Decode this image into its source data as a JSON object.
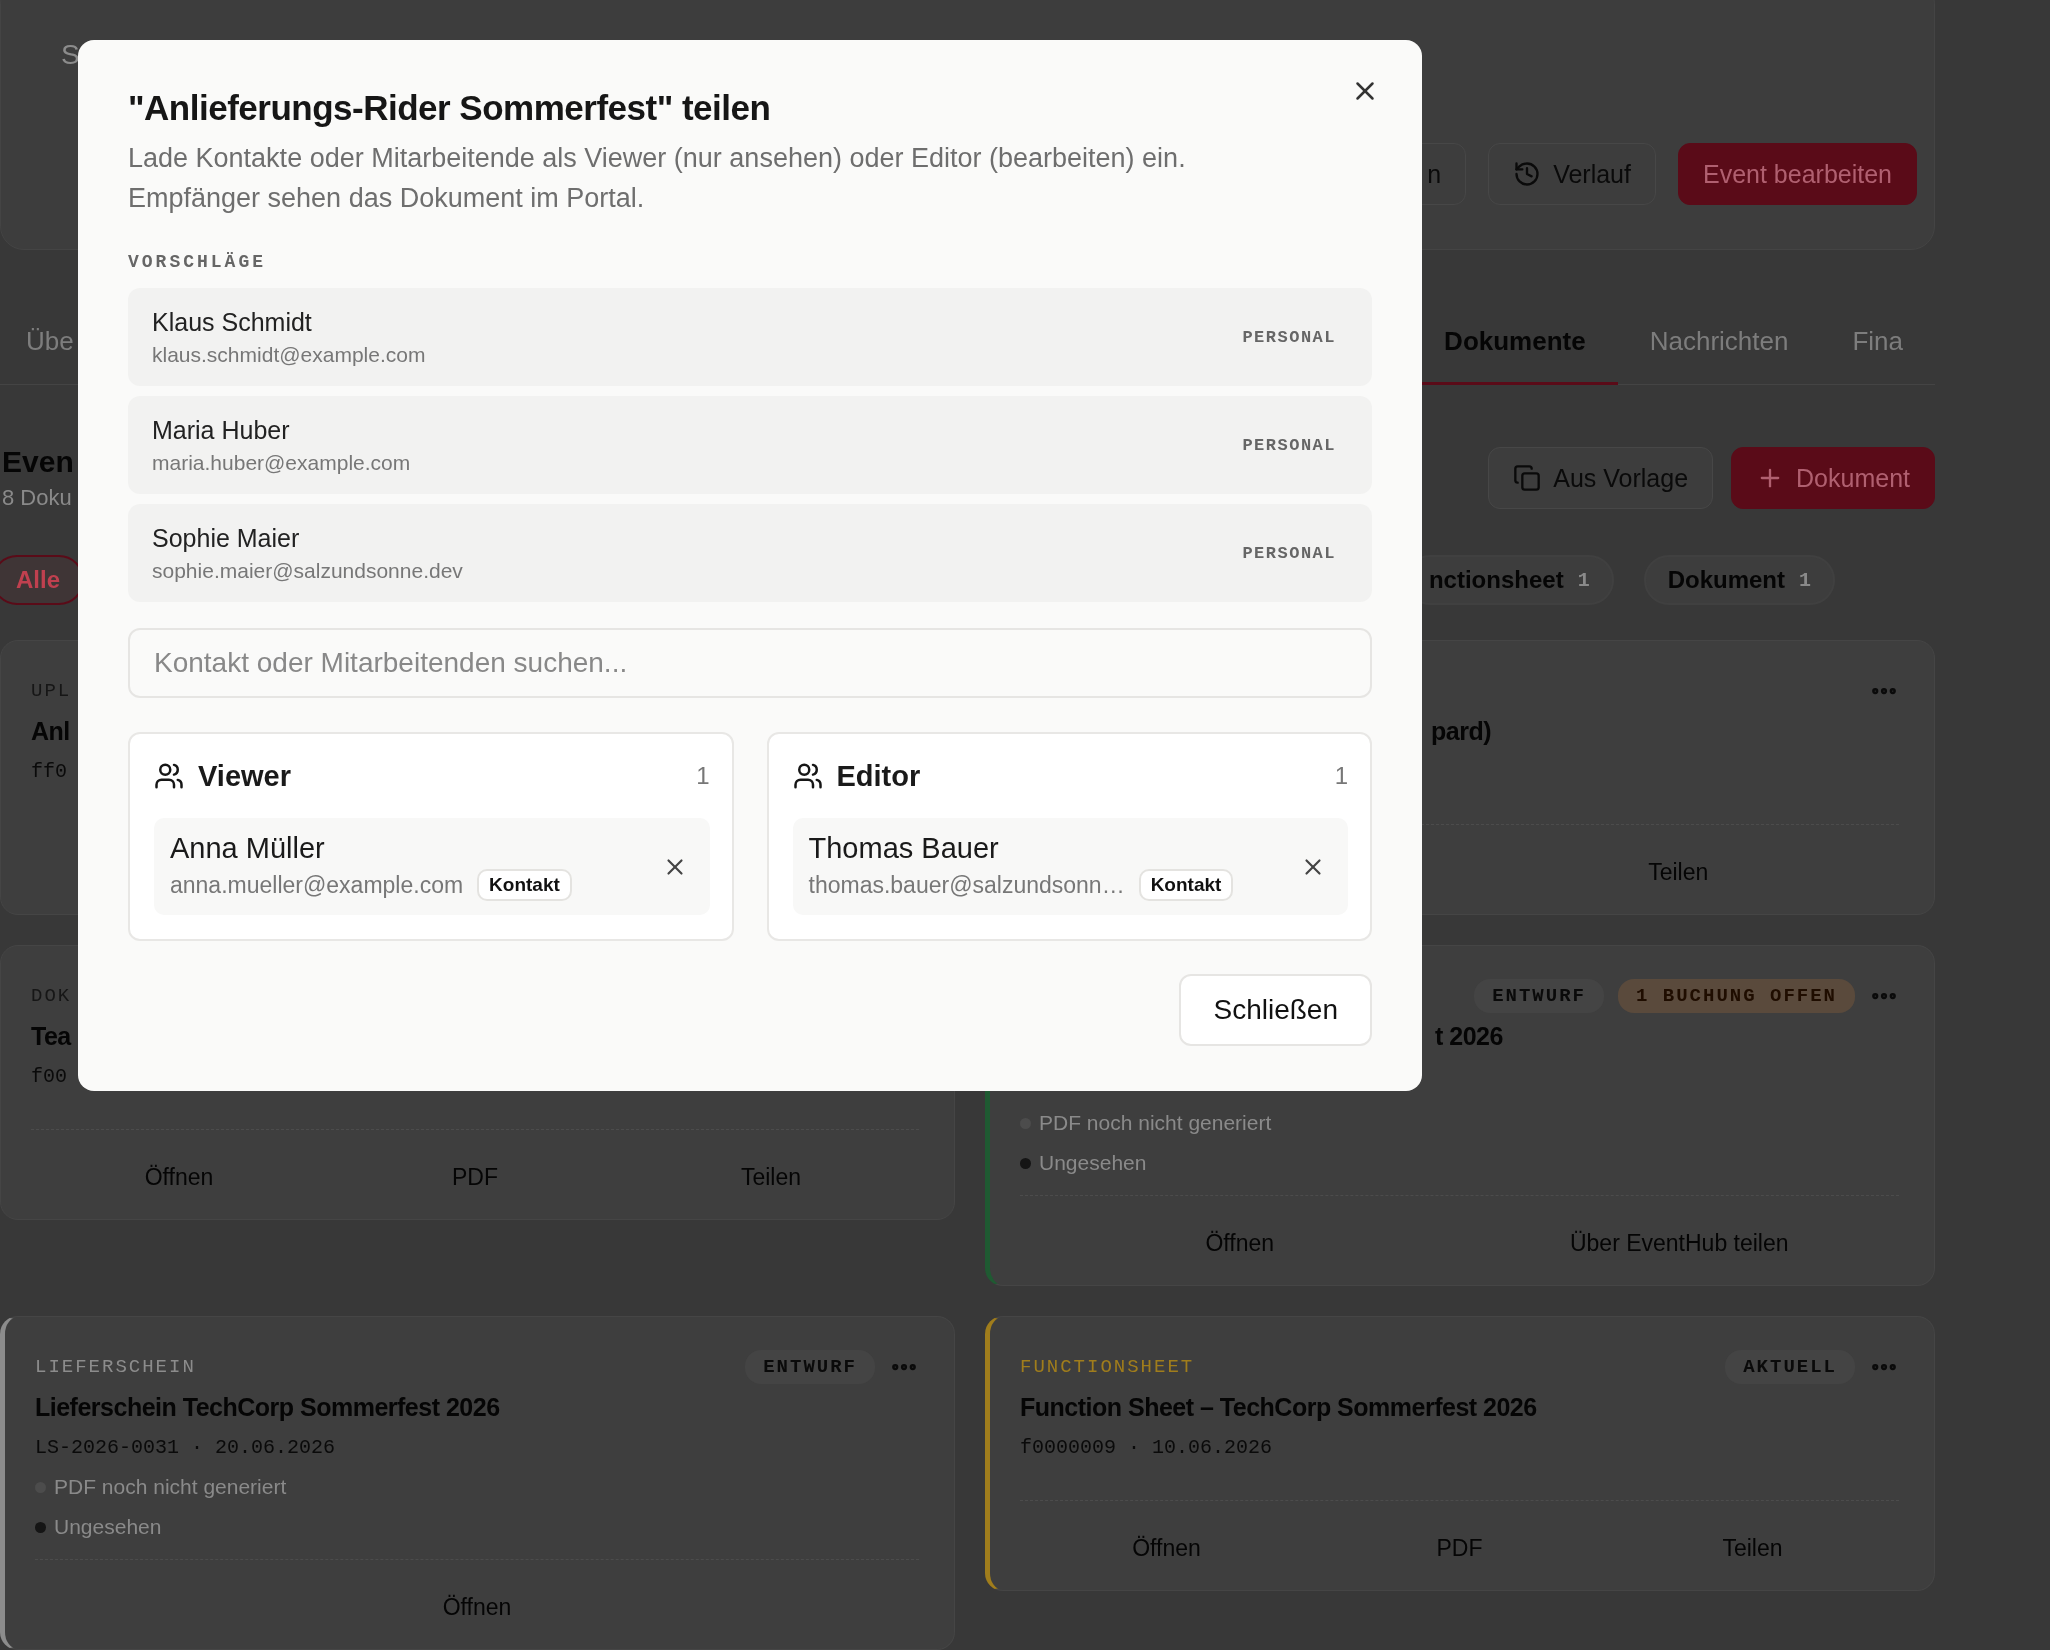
{
  "header": {
    "subtitle": "S",
    "partial_button": {
      "label": "n"
    },
    "history_button": {
      "label": "Verlauf"
    },
    "edit_button": {
      "label": "Event bearbeiten"
    }
  },
  "tabs": [
    {
      "label": "Übe",
      "selected": false
    },
    {
      "label": "Dokumente",
      "selected": true
    },
    {
      "label": "Nachrichten",
      "selected": false
    },
    {
      "label": "Fina",
      "selected": false
    }
  ],
  "section": {
    "title": "Even",
    "subtitle": "8 Doku",
    "template_button": {
      "label": "Aus Vorlage"
    },
    "new_button": {
      "label": "Dokument"
    }
  },
  "filters": [
    {
      "label": "Alle",
      "selected": true
    },
    {
      "label": "nctionsheet",
      "count": "1",
      "selected": false
    },
    {
      "label": "Dokument",
      "count": "1",
      "selected": false
    }
  ],
  "cards": [
    {
      "type": "UPL",
      "title": "Anl",
      "meta": "ff0"
    },
    {
      "kind": "pair",
      "title": "pard)",
      "title_cut": true,
      "menu": true,
      "actions": [
        "Teilen"
      ]
    },
    {
      "kind": "triple",
      "type": "DOK",
      "title": "Tea",
      "meta": "f00",
      "actions": [
        "Öffnen",
        "PDF",
        "Teilen"
      ]
    },
    {
      "kind": "pair",
      "color": "#1f5a32",
      "title": "t 2026",
      "title_cut": true,
      "menu": true,
      "badges": [
        {
          "label": "ENTWURF",
          "kind": "neutral"
        },
        {
          "label": "1 BUCHUNG OFFEN",
          "kind": "warning"
        }
      ],
      "statuses": [
        {
          "label": "PDF noch nicht generiert",
          "color": "#4c4c4c"
        },
        {
          "label": "Ungesehen",
          "color": "#151515"
        }
      ],
      "actions": [
        "Öffnen",
        "Über EventHub teilen"
      ]
    },
    {
      "kind": "single",
      "color": "#8c8c8c",
      "type": "LIEFERSCHEIN",
      "title": "Lieferschein TechCorp Sommerfest 2026",
      "meta": "LS-2026-0031 · 20.06.2026",
      "menu": true,
      "badges": [
        {
          "label": "ENTWURF",
          "kind": "neutral"
        }
      ],
      "statuses": [
        {
          "label": "PDF noch nicht generiert",
          "color": "#4c4c4c"
        },
        {
          "label": "Ungesehen",
          "color": "#151515"
        }
      ],
      "actions": [
        "Öffnen"
      ]
    },
    {
      "kind": "triple",
      "color": "#a07d1c",
      "type": "FUNCTIONSHEET",
      "title": "Function Sheet – TechCorp Sommerfest 2026",
      "meta": "f0000009 · 10.06.2026",
      "menu": true,
      "badges": [
        {
          "label": "AKTUELL",
          "kind": "neutral"
        }
      ],
      "actions": [
        "Öffnen",
        "PDF",
        "Teilen"
      ]
    }
  ],
  "dialog": {
    "title": "\"Anlieferungs-Rider Sommerfest\" teilen",
    "description": "Lade Kontakte oder Mitarbeitende als Viewer (nur ansehen) oder Editor (bearbeiten) ein. Empfänger sehen das Dokument im Portal.",
    "suggestions_heading": "VORSCHLÄGE",
    "suggestions": [
      {
        "name": "Klaus Schmidt",
        "email": "klaus.schmidt@example.com",
        "role": "PERSONAL"
      },
      {
        "name": "Maria Huber",
        "email": "maria.huber@example.com",
        "role": "PERSONAL"
      },
      {
        "name": "Sophie Maier",
        "email": "sophie.maier@salzundsonne.dev",
        "role": "PERSONAL"
      }
    ],
    "search": {
      "placeholder": "Kontakt oder Mitarbeitenden suchen..."
    },
    "groups": [
      {
        "title": "Viewer",
        "count": "1",
        "members": [
          {
            "name": "Anna Müller",
            "email": "anna.mueller@example.com",
            "tag": "Kontakt"
          }
        ]
      },
      {
        "title": "Editor",
        "count": "1",
        "members": [
          {
            "name": "Thomas Bauer",
            "email": "thomas.bauer@salzundsonn…",
            "tag": "Kontakt"
          }
        ]
      }
    ],
    "close_button": "Schließen"
  }
}
